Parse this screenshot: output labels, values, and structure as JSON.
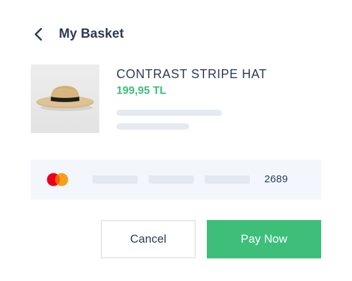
{
  "header": {
    "back_icon": "chevron-left-icon",
    "title": "My Basket"
  },
  "product": {
    "image_icon": "straw-hat-image",
    "name": "CONTRAST STRIPE HAT",
    "price": "199,95 TL"
  },
  "payment": {
    "card_brand_icon": "mastercard-icon",
    "last4": "2689"
  },
  "actions": {
    "cancel_label": "Cancel",
    "pay_label": "Pay Now"
  },
  "colors": {
    "accent": "#3dbf7a",
    "text": "#2b3a55",
    "card_bg": "#f3f6fd",
    "skeleton": "#e4e9f2"
  }
}
